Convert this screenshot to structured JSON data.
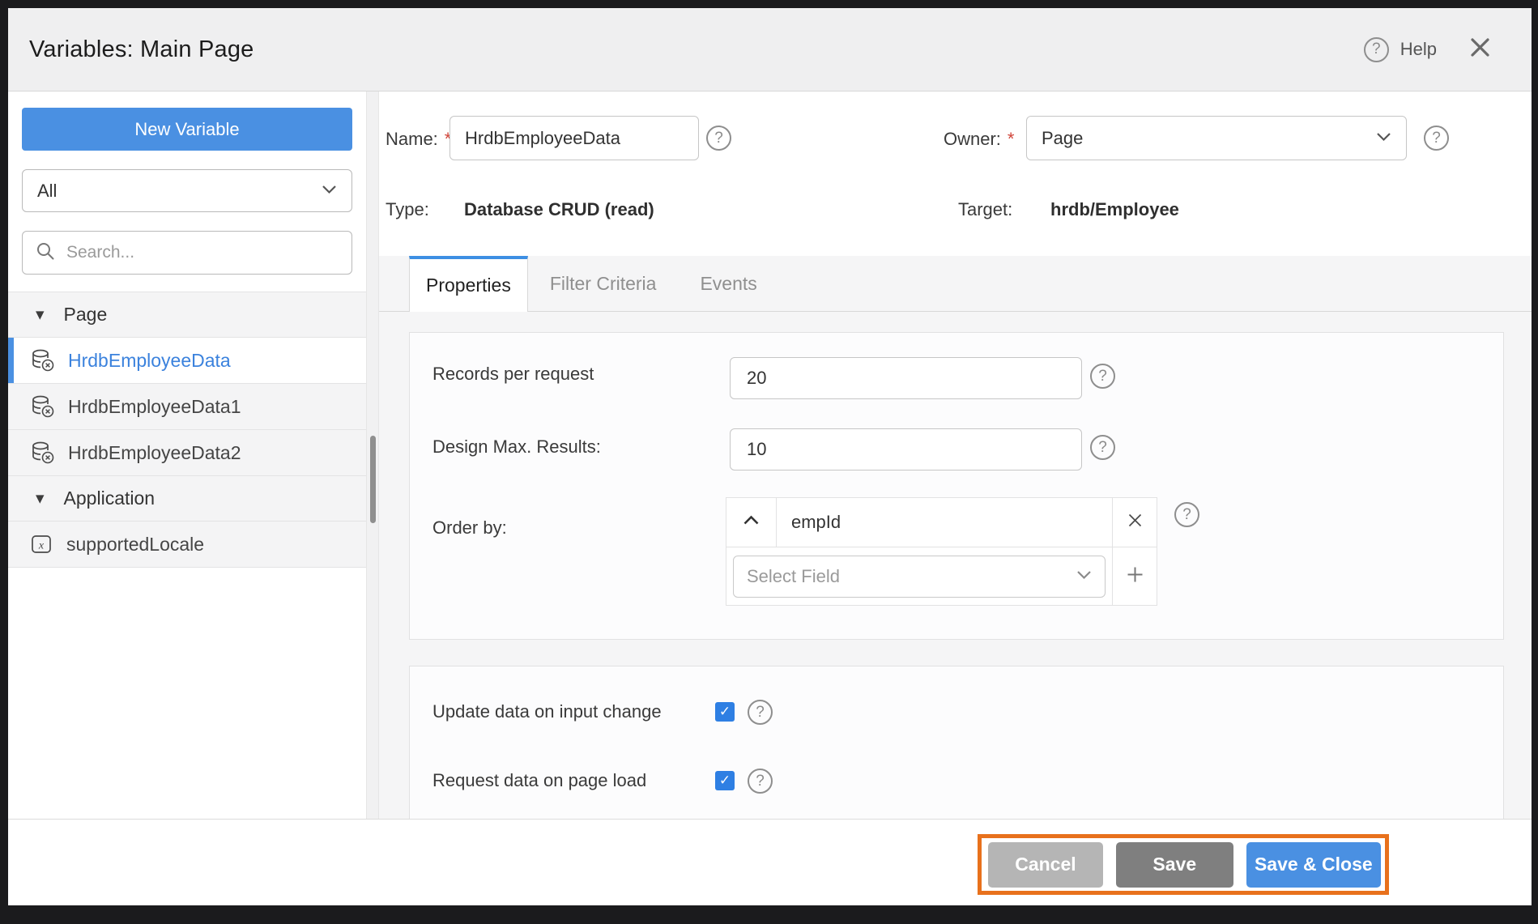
{
  "header": {
    "title": "Variables: Main Page",
    "help_label": "Help"
  },
  "icons": {
    "question": "?",
    "caret_down": "▾"
  },
  "sidebar": {
    "new_variable_label": "New Variable",
    "filter_value": "All",
    "search_placeholder": "Search...",
    "groups": [
      {
        "label": "Page",
        "items": [
          {
            "label": "HrdbEmployeeData",
            "icon": "database-crud-icon",
            "selected": true
          },
          {
            "label": "HrdbEmployeeData1",
            "icon": "database-crud-icon",
            "selected": false
          },
          {
            "label": "HrdbEmployeeData2",
            "icon": "database-crud-icon",
            "selected": false
          }
        ]
      },
      {
        "label": "Application",
        "items": [
          {
            "label": "supportedLocale",
            "icon": "variable-x-icon",
            "selected": false
          }
        ]
      }
    ]
  },
  "form": {
    "name": {
      "label": "Name:",
      "required": "*",
      "value": "HrdbEmployeeData"
    },
    "owner": {
      "label": "Owner:",
      "required": "*",
      "value": "Page"
    },
    "type": {
      "label": "Type:",
      "value": "Database CRUD (read)"
    },
    "target": {
      "label": "Target:",
      "value": "hrdb/Employee"
    }
  },
  "tabs": [
    {
      "label": "Properties",
      "active": true
    },
    {
      "label": "Filter Criteria",
      "active": false
    },
    {
      "label": "Events",
      "active": false
    }
  ],
  "properties": {
    "records_per_request": {
      "label": "Records per request",
      "value": "20"
    },
    "design_max_results": {
      "label": "Design Max. Results:",
      "value": "10"
    },
    "order_by": {
      "label": "Order by:",
      "sort_field": "empId",
      "sort_direction": "ascending",
      "select_placeholder": "Select Field"
    },
    "update_on_input_change": {
      "label": "Update data on input change",
      "checked": true
    },
    "request_on_page_load": {
      "label": "Request data on page load",
      "checked": true
    }
  },
  "footer": {
    "cancel_label": "Cancel",
    "save_label": "Save",
    "save_close_label": "Save & Close"
  },
  "colors": {
    "accent_blue": "#4a90e2",
    "checkbox_blue": "#2e7fe3",
    "selected_item_text": "#3b82dd",
    "annotation_orange": "#e8711c",
    "cancel_gray": "#b5b5b5",
    "save_gray": "#7f7f7f"
  }
}
